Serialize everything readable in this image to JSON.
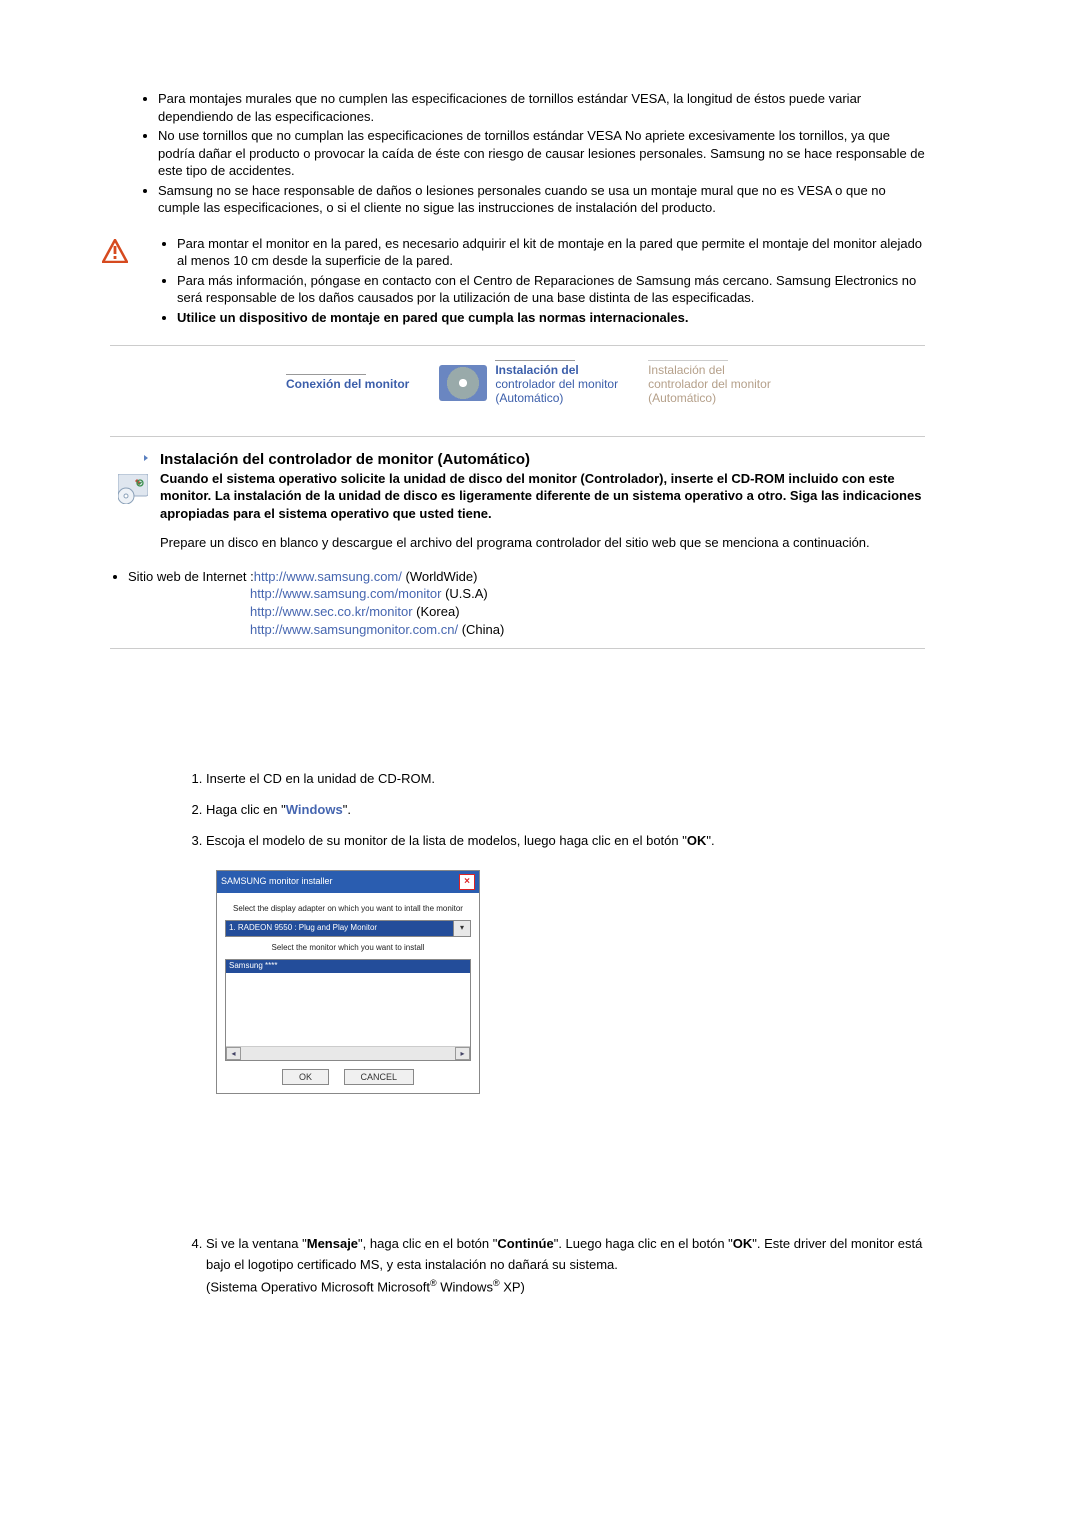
{
  "top_list": {
    "group1": [
      "Para montajes murales que no cumplen las especificaciones de tornillos estándar VESA, la longitud de éstos puede variar dependiendo de las especificaciones.",
      "No use tornillos que no cumplan las especificaciones de tornillos estándar VESA No apriete excesivamente los tornillos, ya que podría dañar el producto o provocar la caída de éste con riesgo de causar lesiones personales. Samsung no se hace responsable de este tipo de accidentes.",
      "Samsung no se hace responsable de daños o lesiones personales cuando se usa un montaje mural que no es VESA o que no cumple las especificaciones, o si el cliente no sigue las instrucciones de instalación del producto."
    ],
    "group2": [
      "Para montar el monitor en la pared, es necesario adquirir el kit de montaje en la pared que permite el montaje del monitor alejado al menos 10 cm desde la superficie de la pared.",
      "Para más información, póngase en contacto con el Centro de Reparaciones de Samsung más cercano. Samsung Electronics no será responsable de los daños causados por la utilización de una base distinta de las especificadas."
    ],
    "group2_last_bold": "Utilice un dispositivo de montaje en pared que cumpla las normas internacionales."
  },
  "tabs": {
    "t1_line1": "Conexión del monitor",
    "t2_line1": "Instalación del",
    "t2_line2": "controlador del monitor",
    "t2_line3": "(Automático)",
    "t3_line1": "Instalación del",
    "t3_line2": "controlador del monitor",
    "t3_line3": "(Automático)"
  },
  "section": {
    "title": "Instalación del controlador de monitor (Automático)",
    "lead": "Cuando el sistema operativo solicite la unidad de disco del monitor (Controlador), inserte el CD-ROM incluido con este monitor. La instalación de la unidad de disco es ligeramente diferente de un sistema operativo a otro. Siga las indicaciones apropiadas para el sistema operativo que usted tiene.",
    "prepare": "Prepare un disco en blanco y descargue el archivo del programa controlador del sitio web que se menciona a continuación."
  },
  "urls": {
    "label": "Sitio web de Internet :",
    "u1": "http://www.samsung.com/",
    "u1_suffix": " (WorldWide)",
    "u2": "http://www.samsung.com/monitor",
    "u2_suffix": " (U.S.A)",
    "u3": "http://www.sec.co.kr/monitor",
    "u3_suffix": " (Korea)",
    "u4": "http://www.samsungmonitor.com.cn/",
    "u4_suffix": " (China)"
  },
  "steps": {
    "s1": "Inserte el CD en la unidad de CD-ROM.",
    "s2_a": "Haga clic en \"",
    "s2_link": "Windows",
    "s2_b": "\".",
    "s3_a": "Escoja el modelo de su monitor de la lista de modelos, luego haga clic en el botón \"",
    "s3_bold": "OK",
    "s3_b": "\".",
    "s4_a": "Si ve la ventana \"",
    "s4_bold1": "Mensaje",
    "s4_b": "\", haga clic en el botón \"",
    "s4_bold2": "Continúe",
    "s4_c": "\". Luego haga clic en el botón \"",
    "s4_bold3": "OK",
    "s4_d": "\". Este driver del monitor está bajo el logotipo certificado MS, y esta instalación no dañará su sistema.",
    "s4_os_a": "(Sistema Operativo Microsoft Microsoft",
    "s4_os_b": " Windows",
    "s4_os_c": " XP)"
  },
  "installer": {
    "title": "SAMSUNG monitor installer",
    "line1": "Select the display adapter on which you want to intall the monitor",
    "combo": "1. RADEON 9550 : Plug and Play Monitor",
    "line2": "Select the monitor which you want to install",
    "listsel": "Samsung ****",
    "ok": "OK",
    "cancel": "CANCEL"
  }
}
